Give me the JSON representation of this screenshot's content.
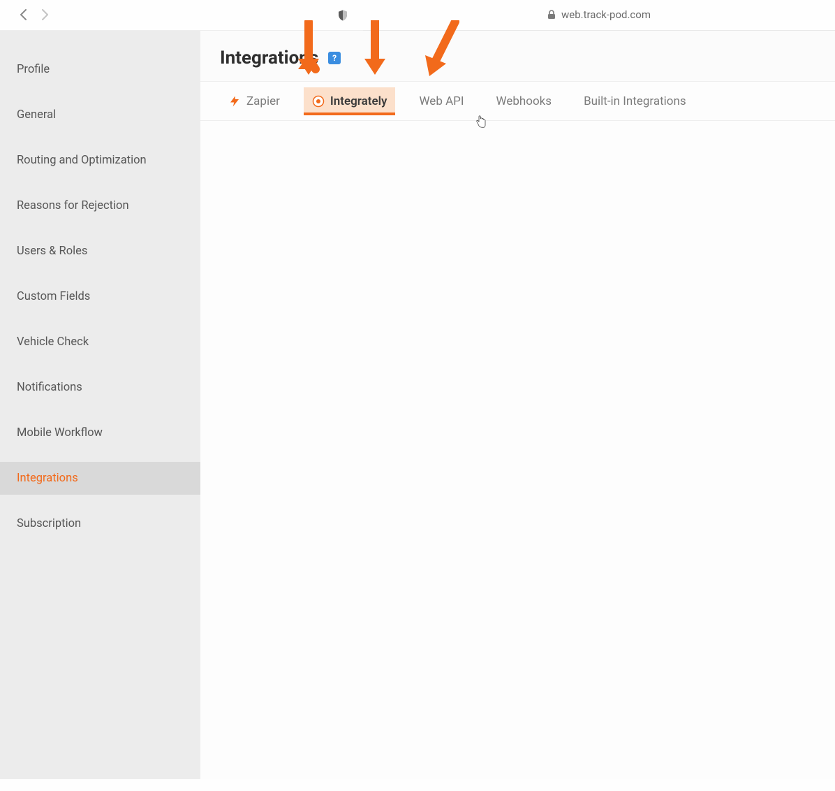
{
  "browser": {
    "url": "web.track-pod.com"
  },
  "sidebar": {
    "items": [
      {
        "label": "Profile"
      },
      {
        "label": "General"
      },
      {
        "label": "Routing and Optimization"
      },
      {
        "label": "Reasons for Rejection"
      },
      {
        "label": "Users & Roles"
      },
      {
        "label": "Custom Fields"
      },
      {
        "label": "Vehicle Check"
      },
      {
        "label": "Notifications"
      },
      {
        "label": "Mobile Workflow"
      },
      {
        "label": "Integrations"
      },
      {
        "label": "Subscription"
      }
    ],
    "active_index": 9
  },
  "header": {
    "title": "Integrations",
    "help": "?"
  },
  "tabs": {
    "items": [
      {
        "label": "Zapier",
        "icon": "bolt-icon"
      },
      {
        "label": "Integrately",
        "icon": "integrately-icon"
      },
      {
        "label": "Web API",
        "icon": null
      },
      {
        "label": "Webhooks",
        "icon": null
      },
      {
        "label": "Built-in Integrations",
        "icon": null
      }
    ],
    "active_index": 1
  },
  "colors": {
    "accent": "#f26a1b",
    "highlight_bg": "#fce0cb",
    "sidebar_bg": "#ececec",
    "sidebar_active_bg": "#d9d9d9",
    "text_muted": "#7c7c7c",
    "help_badge": "#3a8de0"
  }
}
